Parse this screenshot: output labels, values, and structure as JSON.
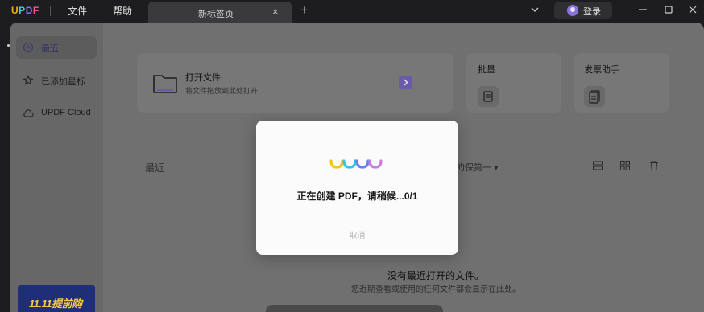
{
  "titlebar": {
    "logo": {
      "u": "U",
      "p": "P",
      "d": "D",
      "f": "F"
    },
    "menu": {
      "file": "文件",
      "help": "帮助"
    },
    "tab": {
      "label": "新标签页",
      "close": "×"
    },
    "add_tab": "+",
    "login": "登录"
  },
  "sidebar": {
    "items": [
      {
        "label": "最近",
        "icon": "clock-icon"
      },
      {
        "label": "已添加星标",
        "icon": "star-icon"
      },
      {
        "label": "UPDF Cloud",
        "icon": "cloud-icon"
      }
    ],
    "promo": "11.11提前购"
  },
  "cards": {
    "open": {
      "title": "打开文件",
      "subtitle": "将文件拖放到此处打开"
    },
    "batch": {
      "title": "批量"
    },
    "invoice": {
      "title": "发票助手"
    }
  },
  "recent": {
    "label": "最近",
    "sort": "的保第一 ▾"
  },
  "empty": {
    "title": "没有最近打开的文件。",
    "subtitle": "您近期查看或使用的任何文件都会显示在此处。"
  },
  "dialog": {
    "message": "正在创建 PDF，请稍候...0/1",
    "cancel": "取消"
  },
  "colors": {
    "accent": "#6a5aa8",
    "loader": [
      "#f6c21b",
      "#3cc1e6",
      "#6b7df2",
      "#c77be8"
    ]
  }
}
